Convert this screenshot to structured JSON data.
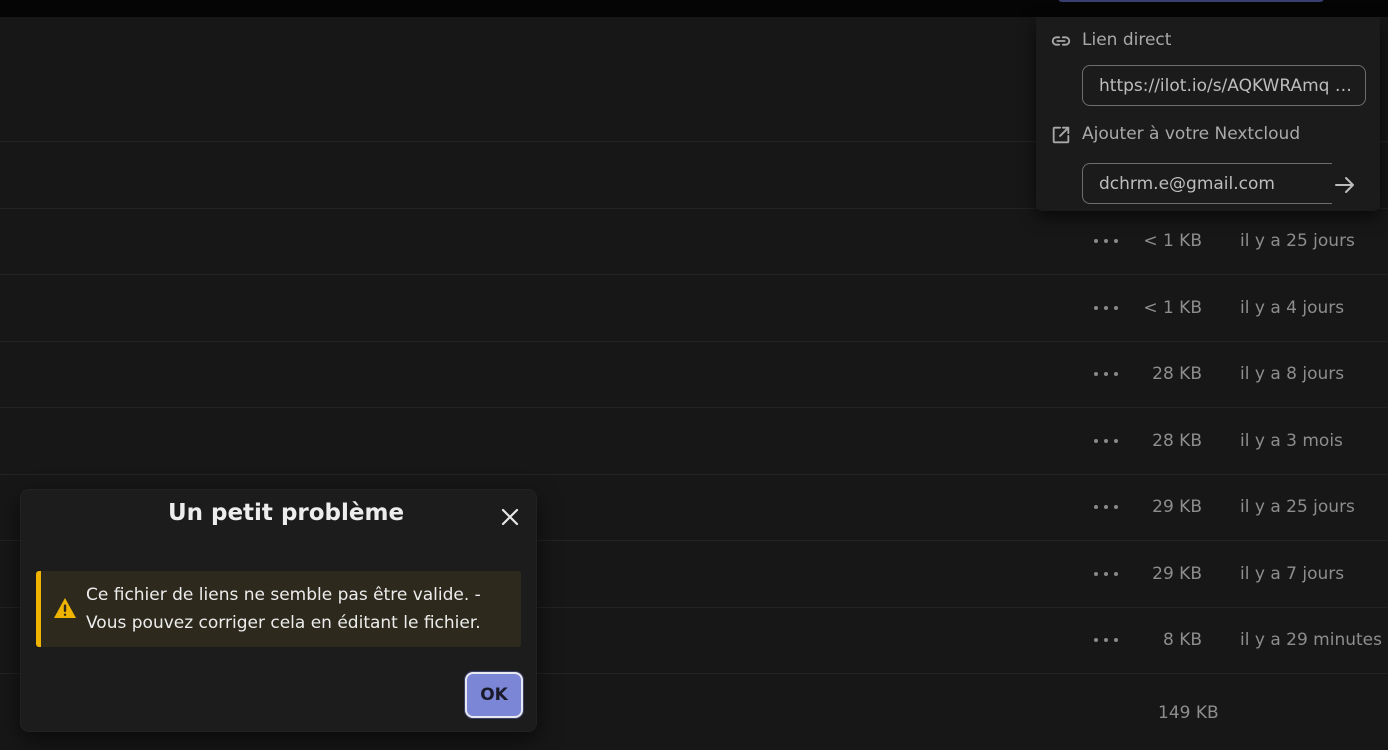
{
  "files": [
    {
      "size": "",
      "date": ""
    },
    {
      "size": "",
      "date": ""
    },
    {
      "size": "< 1 KB",
      "date": "il y a 25 jours"
    },
    {
      "size": "< 1 KB",
      "date": "il y a 4 jours"
    },
    {
      "size": "28 KB",
      "date": "il y a 8 jours"
    },
    {
      "size": "28 KB",
      "date": "il y a 3 mois"
    },
    {
      "size": "29 KB",
      "date": "il y a 25 jours"
    },
    {
      "size": "29 KB",
      "date": "il y a 7 jours"
    },
    {
      "size": "8 KB",
      "date": "il y a 29 minutes"
    }
  ],
  "total_size": "149 KB",
  "share": {
    "direct_link_label": "Lien direct",
    "direct_link_value": "https://ilot.io/s/AQKWRAmq …",
    "nextcloud_label": "Ajouter à votre Nextcloud",
    "nextcloud_value": "dchrm.e@gmail.com"
  },
  "dialog": {
    "title": "Un petit problème",
    "message_line1": "Ce fichier de liens ne semble pas être valide. -",
    "message_line2": "Vous pouvez corriger cela en éditant le fichier.",
    "ok_label": "OK"
  },
  "colors": {
    "accent": "#7b86d6",
    "warning": "#f0b400",
    "background": "#171717"
  }
}
